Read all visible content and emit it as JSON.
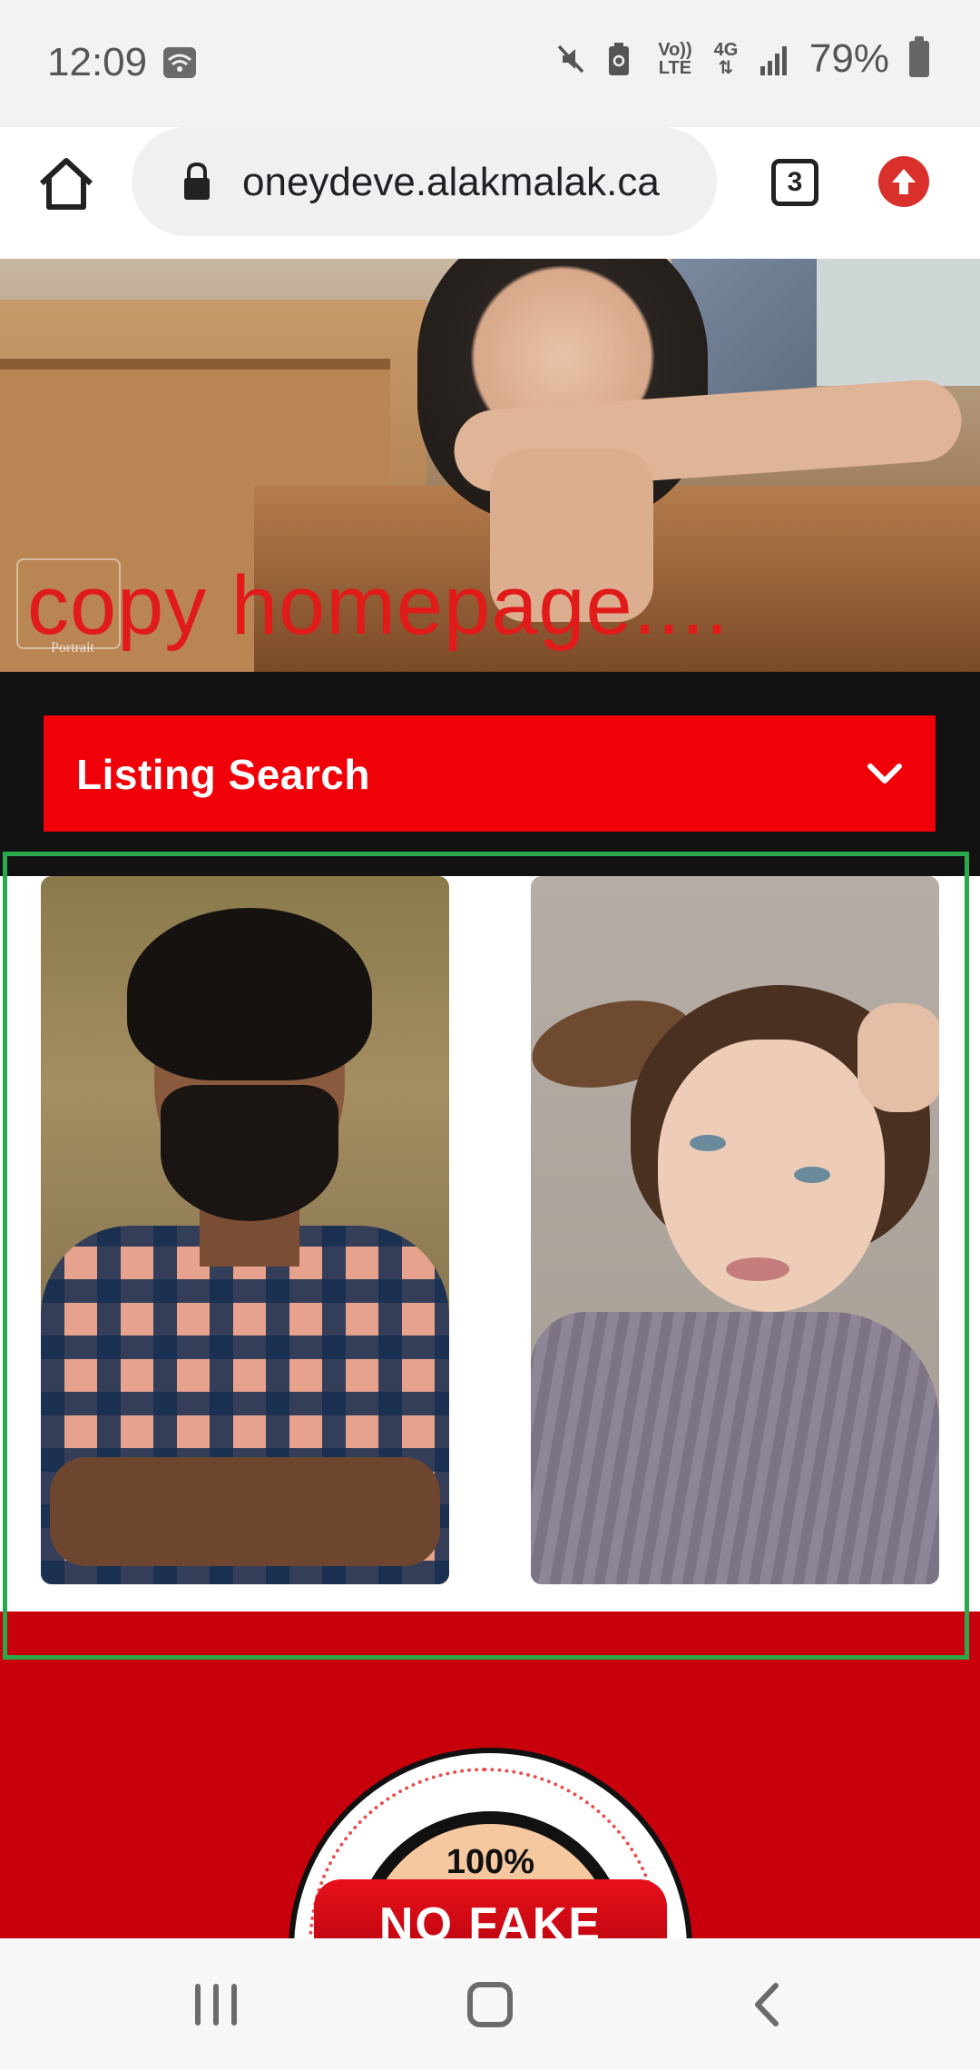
{
  "status_bar": {
    "time": "12:09",
    "network_text_top": "Vo))",
    "network_text_bottom": "LTE",
    "network_gen": "4G",
    "battery_percent": "79%",
    "icons": [
      "wifi-icon",
      "mute-icon",
      "battery-saver-icon",
      "signal-icon",
      "battery-icon"
    ]
  },
  "browser": {
    "url": "oneydeve.alakmalak.ca",
    "tab_count": "3",
    "icons": [
      "home-icon",
      "lock-icon",
      "tabs-icon",
      "upload-icon"
    ],
    "accent_color": "#d9302c"
  },
  "hero": {
    "title": "copy homepage....",
    "watermark_text": "Portrait",
    "title_color": "#e11a1a"
  },
  "search": {
    "label": "Listing Search",
    "icon": "chevron-down-icon",
    "bar_color": "#f00008"
  },
  "profiles": [
    {
      "alt": "man-portrait"
    },
    {
      "alt": "woman-portrait"
    }
  ],
  "badge": {
    "percent": "100%",
    "text": "NO FAKE",
    "section_color": "#c7000c"
  },
  "nav": {
    "icons": [
      "recents-icon",
      "home-button-icon",
      "back-icon"
    ]
  }
}
